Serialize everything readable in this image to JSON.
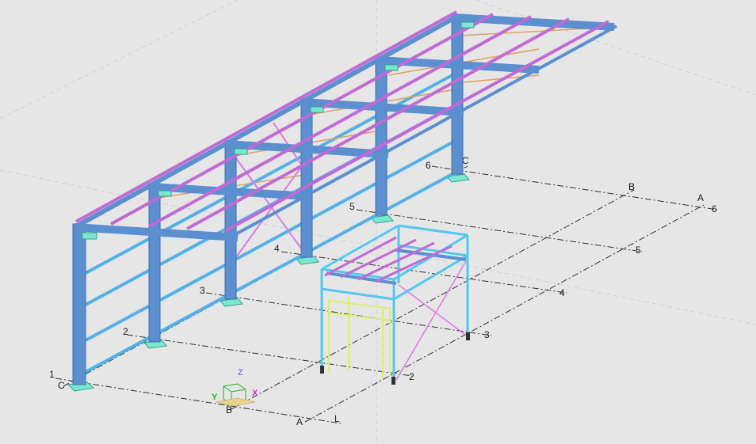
{
  "viewport": {
    "background": "#e6e6e6",
    "colors": {
      "steel": "#5b8fcf",
      "steel_dark": "#3f6fa9",
      "purlin": "#c06ad6",
      "brace": "#d77be0",
      "tie": "#e0a060",
      "base_plate": "#79e8d0",
      "new_frame": "#52c8f0",
      "new_frame_inner": "#d8ef70",
      "grid_line": "#303030"
    }
  },
  "grid_labels": {
    "row_1": "1",
    "row_2": "2",
    "row_3": "3",
    "row_4": "4",
    "row_5": "5",
    "row_6": "6",
    "col_c_front": "C",
    "col_b_front": "B",
    "col_a_front": "A",
    "col_l_front": "L",
    "col_c_back": "C",
    "col_b_back": "B",
    "col_a_back": "A",
    "right_2": "2",
    "right_3": "3",
    "right_4": "4",
    "right_5": "5",
    "right_6": "6"
  },
  "axis_triad": {
    "x_label": "X",
    "y_label": "Y",
    "z_label": "Z",
    "x_color": "#c040c0",
    "y_color": "#20b020",
    "z_color": "#8080e0"
  }
}
